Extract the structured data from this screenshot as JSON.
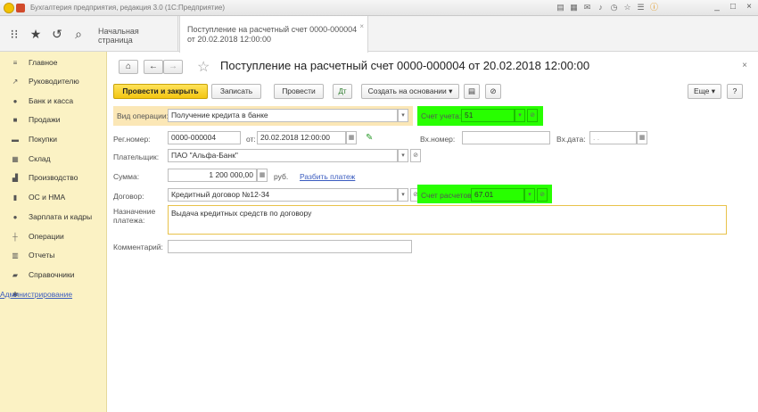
{
  "window": {
    "title": "Бухгалтерия предприятия, редакция 3.0 (1С:Предприятие)",
    "icons": [
      "list-icon",
      "table-icon",
      "mail-icon",
      "bell-icon",
      "history-icon",
      "star-icon",
      "menu-icon",
      "info-icon"
    ],
    "win_buttons": [
      "_",
      "□",
      "×"
    ]
  },
  "tabs": {
    "home": "Начальная страница",
    "doc_line1": "Поступление на расчетный счет 0000-000004",
    "doc_line2": "от 20.02.2018 12:00:00",
    "close": "×"
  },
  "sidebar": {
    "items": [
      {
        "label": "Главное",
        "icon": "menu-icon",
        "glyph": "≡"
      },
      {
        "label": "Руководителю",
        "icon": "trend-icon",
        "glyph": "↗"
      },
      {
        "label": "Банк и касса",
        "icon": "bank-icon",
        "glyph": "●"
      },
      {
        "label": "Продажи",
        "icon": "bag-icon",
        "glyph": "■"
      },
      {
        "label": "Покупки",
        "icon": "cart-icon",
        "glyph": "▬"
      },
      {
        "label": "Склад",
        "icon": "warehouse-icon",
        "glyph": "▦"
      },
      {
        "label": "Производство",
        "icon": "factory-icon",
        "glyph": "▟"
      },
      {
        "label": "ОС и НМА",
        "icon": "assets-icon",
        "glyph": "▮"
      },
      {
        "label": "Зарплата и кадры",
        "icon": "person-icon",
        "glyph": "●"
      },
      {
        "label": "Операции",
        "icon": "operations-icon",
        "glyph": "┼"
      },
      {
        "label": "Отчеты",
        "icon": "report-icon",
        "glyph": "▥"
      },
      {
        "label": "Справочники",
        "icon": "book-icon",
        "glyph": "▰"
      },
      {
        "label": "Администрирование",
        "icon": "gear-icon",
        "glyph": "✱"
      }
    ]
  },
  "header": {
    "title": "Поступление на расчетный счет 0000-000004 от 20.02.2018 12:00:00",
    "close": "×"
  },
  "toolbar": {
    "post_close": "Провести и закрыть",
    "save": "Записать",
    "post": "Провести",
    "create_based": "Создать на основании",
    "more": "Еще",
    "help": "?"
  },
  "form": {
    "op_type_label": "Вид операции:",
    "op_type_value": "Получение кредита в банке",
    "account_label": "Счет учета:",
    "account_value": "51",
    "reg_num_label": "Рег.номер:",
    "reg_num_value": "0000-000004",
    "date_from_label": "от:",
    "date_value": "20.02.2018 12:00:00",
    "in_num_label": "Вх.номер:",
    "in_num_value": "",
    "in_date_label": "Вх.дата:",
    "in_date_value": " .  .",
    "payer_label": "Плательщик:",
    "payer_value": "ПАО \"Альфа-Банк\"",
    "sum_label": "Сумма:",
    "sum_value": "1 200 000,00",
    "currency": "руб.",
    "split_payment": "Разбить платеж",
    "contract_label": "Договор:",
    "contract_value": "Кредитный договор №12-34",
    "settle_account_label": "Счет расчетов:",
    "settle_account_value": "67.01",
    "purpose_label_1": "Назначение",
    "purpose_label_2": "платежа:",
    "purpose_value": "Выдача кредитных средств по договору",
    "comment_label": "Комментарий:",
    "comment_value": ""
  },
  "colors": {
    "sidebar_bg": "#fbf2c4",
    "primary_button": "#f3c512",
    "highlight_green": "#28ff00",
    "highlight_yellow": "#fbe7b6",
    "link": "#3a5bbf"
  }
}
